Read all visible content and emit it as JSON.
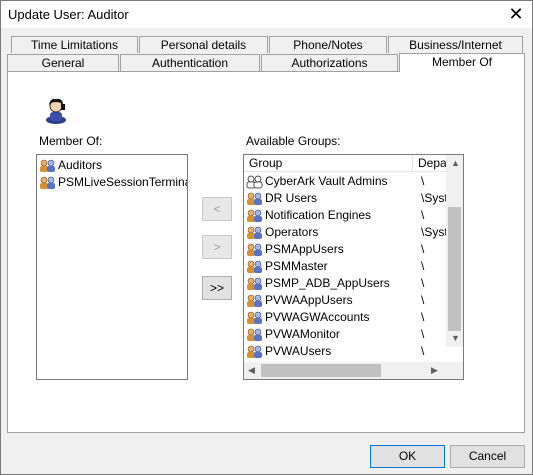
{
  "window": {
    "title": "Update User: Auditor",
    "close_symbol": "✕"
  },
  "tabs_row1": [
    {
      "label": "Time Limitations"
    },
    {
      "label": "Personal details"
    },
    {
      "label": "Phone/Notes"
    },
    {
      "label": "Business/Internet"
    }
  ],
  "tabs_row2": [
    {
      "label": "General"
    },
    {
      "label": "Authentication"
    },
    {
      "label": "Authorizations"
    },
    {
      "label": "Member Of",
      "active": true
    }
  ],
  "member_of": {
    "label": "Member Of:",
    "items": [
      {
        "name": "Auditors"
      },
      {
        "name": "PSMLiveSessionTermina..."
      }
    ]
  },
  "available_groups": {
    "label": "Available Groups:",
    "columns": [
      "Group",
      "Depa"
    ],
    "rows": [
      {
        "group": "CyberArk Vault Admins",
        "dept": "\\"
      },
      {
        "group": "DR Users",
        "dept": "\\Syst"
      },
      {
        "group": "Notification Engines",
        "dept": "\\"
      },
      {
        "group": "Operators",
        "dept": "\\Syst"
      },
      {
        "group": "PSMAppUsers",
        "dept": "\\"
      },
      {
        "group": "PSMMaster",
        "dept": "\\"
      },
      {
        "group": "PSMP_ADB_AppUsers",
        "dept": "\\"
      },
      {
        "group": "PVWAAppUsers",
        "dept": "\\"
      },
      {
        "group": "PVWAGWAccounts",
        "dept": "\\"
      },
      {
        "group": "PVWAMonitor",
        "dept": "\\"
      },
      {
        "group": "PVWAUsers",
        "dept": "\\"
      }
    ]
  },
  "move_buttons": {
    "remove_label": "<",
    "add_label": ">",
    "add_all_label": ">>"
  },
  "footer": {
    "ok_label": "OK",
    "cancel_label": "Cancel"
  },
  "icons": {
    "user": "user-icon",
    "group": "group-icon",
    "close": "close-icon"
  }
}
